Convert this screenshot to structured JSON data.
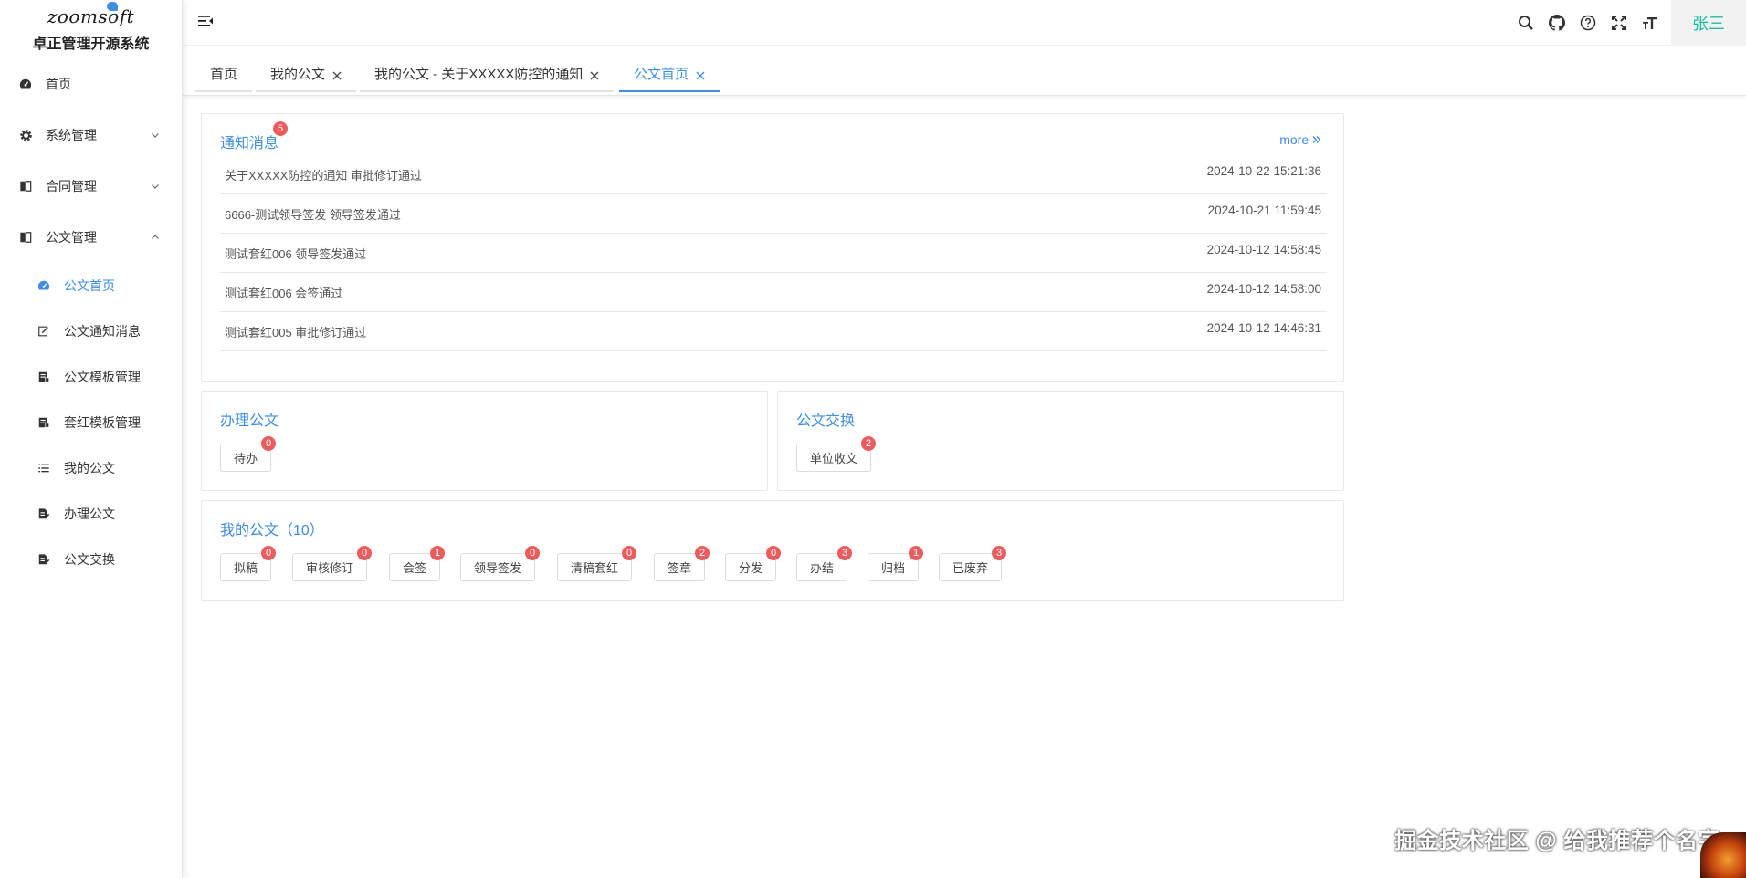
{
  "app": {
    "logo_text": "zoomsoft",
    "title": "卓正管理开源系统"
  },
  "sidebar": {
    "items": [
      {
        "label": "首页",
        "icon": "dashboard-icon"
      },
      {
        "label": "系统管理",
        "icon": "gear-icon"
      },
      {
        "label": "合同管理",
        "icon": "book-icon"
      },
      {
        "label": "公文管理",
        "icon": "book-icon"
      }
    ],
    "sub_items": [
      {
        "label": "公文首页",
        "icon": "dashboard-icon",
        "active": true
      },
      {
        "label": "公文通知消息",
        "icon": "edit-icon"
      },
      {
        "label": "公文模板管理",
        "icon": "template-icon"
      },
      {
        "label": "套红模板管理",
        "icon": "template-icon"
      },
      {
        "label": "我的公文",
        "icon": "list-icon"
      },
      {
        "label": "办理公文",
        "icon": "doc-edit-icon"
      },
      {
        "label": "公文交换",
        "icon": "doc-edit-icon"
      }
    ]
  },
  "header": {
    "user": "张三",
    "tools": [
      "search-icon",
      "github-icon",
      "help-icon",
      "fullscreen-icon",
      "font-size-icon"
    ]
  },
  "tabs": [
    {
      "label": "首页",
      "closable": false,
      "active": false
    },
    {
      "label": "我的公文",
      "closable": true,
      "active": false
    },
    {
      "label": "我的公文 - 关于XXXXX防控的通知",
      "closable": true,
      "active": false
    },
    {
      "label": "公文首页",
      "closable": true,
      "active": true
    }
  ],
  "notice": {
    "title": "通知消息",
    "badge": "5",
    "more": "more",
    "rows": [
      {
        "text": "关于XXXXX防控的通知 审批修订通过",
        "time": "2024-10-22 15:21:36"
      },
      {
        "text": "6666-测试领导签发 领导签发通过",
        "time": "2024-10-21 11:59:45"
      },
      {
        "text": "测试套红006 领导签发通过",
        "time": "2024-10-12 14:58:45"
      },
      {
        "text": "测试套红006 会签通过",
        "time": "2024-10-12 14:58:00"
      },
      {
        "text": "测试套红005 审批修订通过",
        "time": "2024-10-12 14:46:31"
      }
    ]
  },
  "handle": {
    "title": "办理公文",
    "buttons": [
      {
        "label": "待办",
        "count": "0"
      }
    ]
  },
  "exchange": {
    "title": "公文交换",
    "buttons": [
      {
        "label": "单位收文",
        "count": "2"
      }
    ]
  },
  "mydocs": {
    "title": "我的公文（10）",
    "buttons": [
      {
        "label": "拟稿",
        "count": "0"
      },
      {
        "label": "审核修订",
        "count": "0"
      },
      {
        "label": "会签",
        "count": "1"
      },
      {
        "label": "领导签发",
        "count": "0"
      },
      {
        "label": "清稿套红",
        "count": "0"
      },
      {
        "label": "签章",
        "count": "2"
      },
      {
        "label": "分发",
        "count": "0"
      },
      {
        "label": "办结",
        "count": "3"
      },
      {
        "label": "归档",
        "count": "1"
      },
      {
        "label": "已废弃",
        "count": "3"
      }
    ]
  },
  "watermark": "掘金技术社区 @ 给我推荐个名字",
  "colors": {
    "accent": "#3a8ee6",
    "badge": "#ed5c5c",
    "user": "#19be9b"
  }
}
